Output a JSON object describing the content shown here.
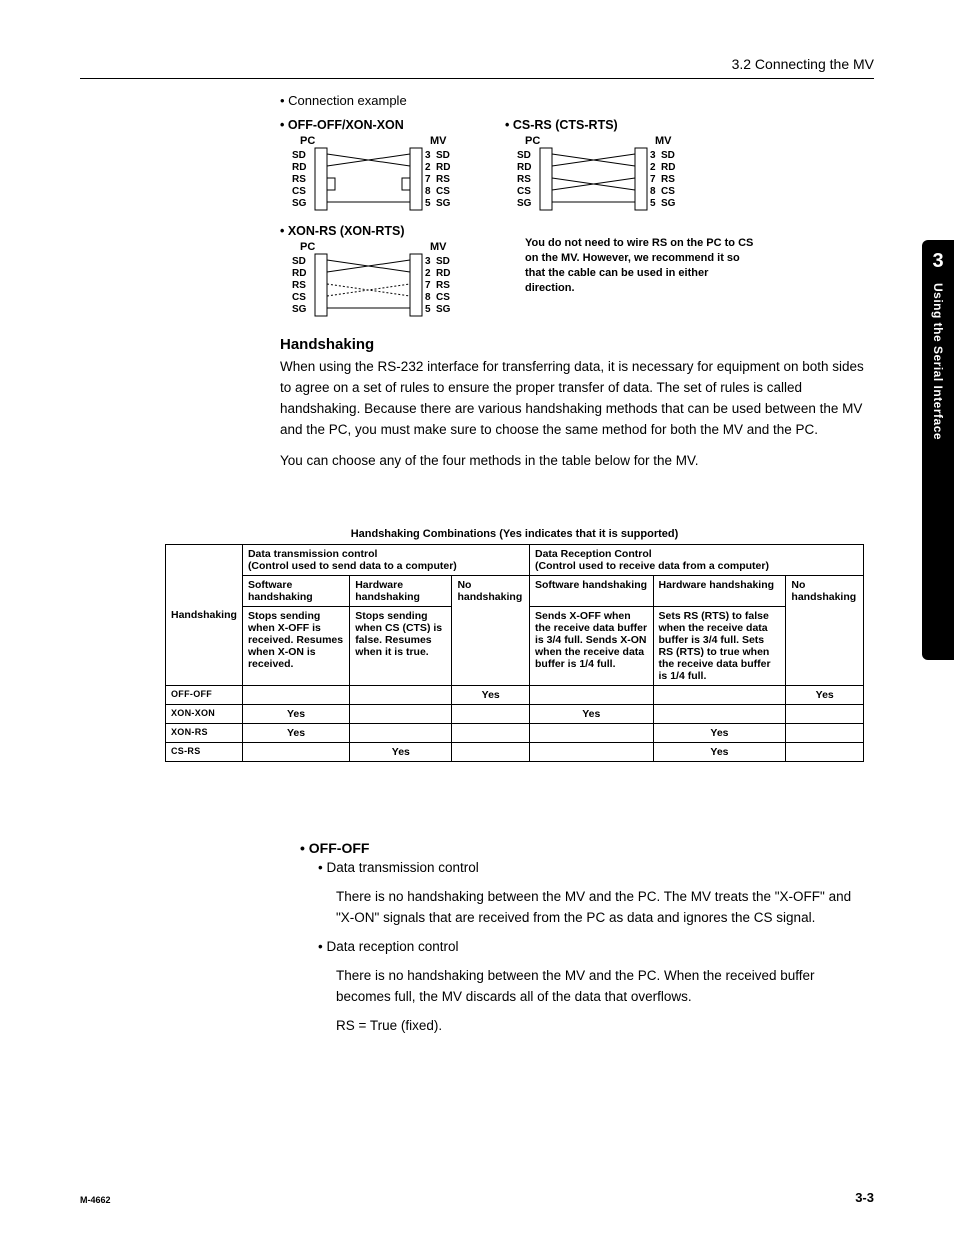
{
  "header": {
    "breadcrumb": "3.2  Connecting the MV"
  },
  "tab": {
    "num": "3",
    "text": "Using the Serial Interface"
  },
  "conn": {
    "bullet": "•   Connection example",
    "d1_title": "• OFF-OFF/XON-XON",
    "d2_title": "• CS-RS (CTS-RTS)",
    "d3_title": "• XON-RS (XON-RTS)",
    "pc": "PC",
    "mv": "MV",
    "pins_left": [
      "SD",
      "RD",
      "RS",
      "CS",
      "SG"
    ],
    "pins_right_nums": [
      "3",
      "2",
      "7",
      "8",
      "5"
    ],
    "pins_right_lbls": [
      "SD",
      "RD",
      "RS",
      "CS",
      "SG"
    ],
    "note": "You do not need to wire RS on the PC to CS on the MV.  However, we recommend it so that the cable can be used in either direction."
  },
  "hand": {
    "title": "Handshaking",
    "p1": "When using the RS-232 interface for transferring data, it is necessary for equipment on both sides to agree on a set of rules to ensure the proper transfer of data. The set of rules is called handshaking. Because there are various handshaking methods that can be used between the MV and the PC, you must make sure to choose the same method for both the MV and the PC.",
    "p2": "You can choose any of the four methods in the table below for the MV."
  },
  "table": {
    "caption": "Handshaking Combinations (Yes indicates that it is supported)",
    "tx_head": "Data transmission control",
    "tx_sub": "(Control used to send data to a computer)",
    "rx_head": "Data Reception Control",
    "rx_sub": "(Control used to receive data from a computer)",
    "sw": "Software handshaking",
    "hw": "Hardware handshaking",
    "nohs": "No handshaking",
    "rowlabel": "Handshaking",
    "tx_sw": "Stops sending when X-OFF is received.  Resumes when X-ON is received.",
    "tx_hw": "Stops sending when CS (CTS) is false.  Resumes when it is true.",
    "rx_sw": "Sends X-OFF when the receive data buffer is 3/4 full.  Sends X-ON when the receive data buffer is 1/4 full.",
    "rx_hw": "Sets RS (RTS) to false when the receive data buffer is 3/4 full.  Sets RS (RTS) to true when the receive data buffer is 1/4 full.",
    "rows": [
      {
        "name": "OFF-OFF",
        "c": [
          "",
          "",
          "Yes",
          "",
          "",
          "Yes"
        ]
      },
      {
        "name": "XON-XON",
        "c": [
          "Yes",
          "",
          "",
          "Yes",
          "",
          ""
        ]
      },
      {
        "name": "XON-RS",
        "c": [
          "Yes",
          "",
          "",
          "",
          "Yes",
          ""
        ]
      },
      {
        "name": "CS-RS",
        "c": [
          "",
          "Yes",
          "",
          "",
          "Yes",
          ""
        ]
      }
    ]
  },
  "off": {
    "title": "•  OFF-OFF",
    "b1": "•   Data transmission control",
    "p1": "There is no handshaking between the MV and the PC. The MV treats the \"X-OFF\" and \"X-ON\" signals that are received from the PC as data and ignores the CS signal.",
    "b2": "•   Data reception control",
    "p2": "There is no handshaking between the MV and the PC. When the received buffer becomes full, the MV discards all of the data that overflows.",
    "p3": "RS = True (fixed)."
  },
  "footer": {
    "left": "M-4662",
    "right": "3-3"
  }
}
